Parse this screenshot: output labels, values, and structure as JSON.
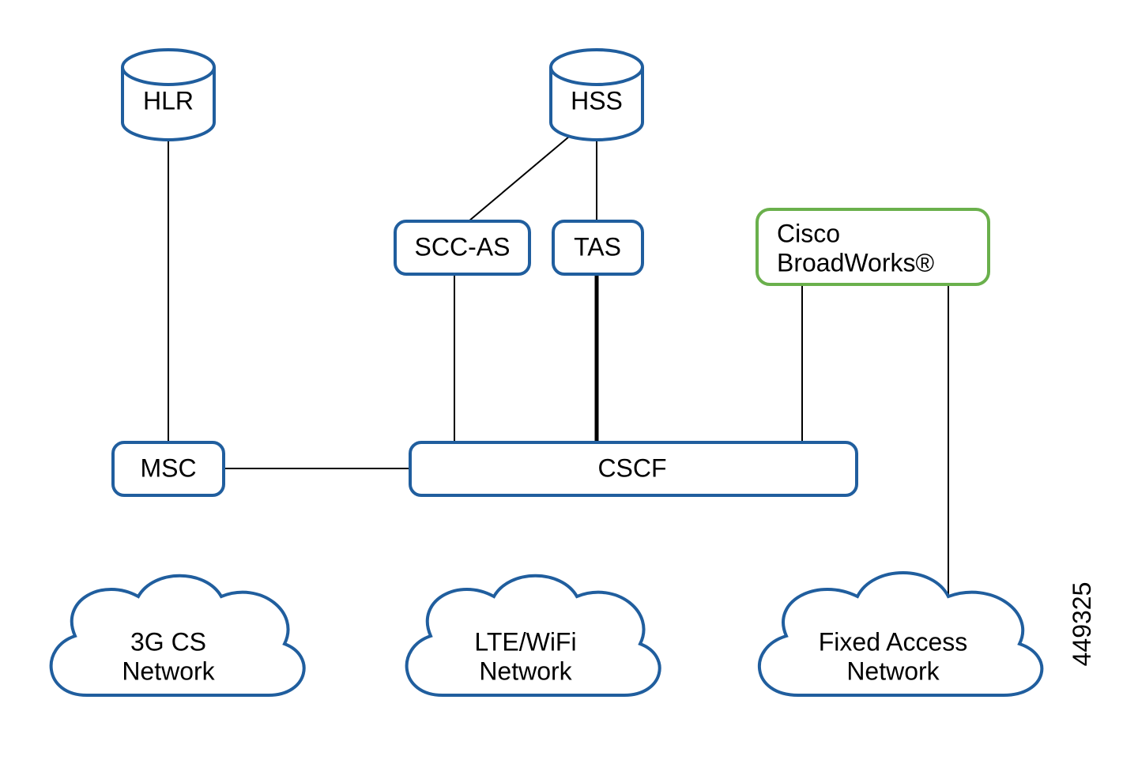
{
  "nodes": {
    "hlr": "HLR",
    "hss": "HSS",
    "scc_as": "SCC-AS",
    "tas": "TAS",
    "broadworks_line1": "Cisco",
    "broadworks_line2": "BroadWorks®",
    "msc": "MSC",
    "cscf": "CSCF"
  },
  "clouds": {
    "cs_line1": "3G CS",
    "cs_line2": "Network",
    "lte_line1": "LTE/WiFi",
    "lte_line2": "Network",
    "fixed_line1": "Fixed Access",
    "fixed_line2": "Network"
  },
  "figure_id": "449325",
  "colors": {
    "blue": "#205e9e",
    "green": "#6ab04c",
    "black": "#000000"
  }
}
